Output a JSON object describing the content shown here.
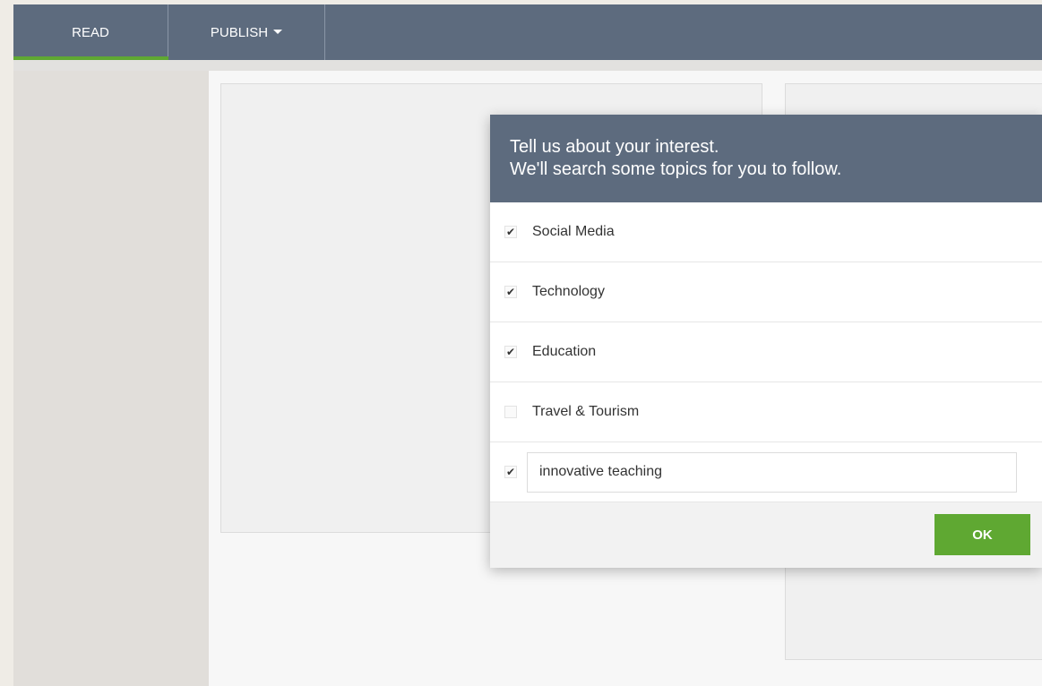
{
  "nav": {
    "tabs": [
      {
        "label": "READ",
        "active": true
      },
      {
        "label": "PUBLISH",
        "has_dropdown": true
      }
    ],
    "active_color": "#5fa832",
    "bar_color": "#5d6b7e"
  },
  "modal": {
    "title_line1": "Tell us about your interest.",
    "title_line2": "We'll search some topics for you to follow.",
    "options": [
      {
        "label": "Social Media",
        "checked": true
      },
      {
        "label": "Technology",
        "checked": true
      },
      {
        "label": "Education",
        "checked": true
      },
      {
        "label": "Travel & Tourism",
        "checked": false
      }
    ],
    "custom": {
      "checked": true,
      "value": "innovative teaching"
    },
    "ok_label": "OK",
    "ok_color": "#5fa832",
    "check_glyph": "✔"
  }
}
